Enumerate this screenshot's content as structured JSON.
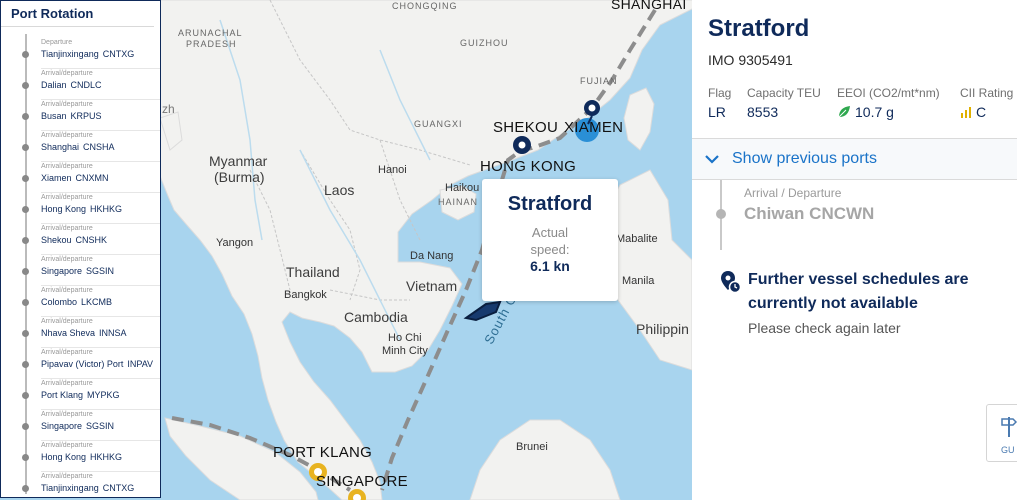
{
  "rotation": {
    "title": "Port Rotation",
    "items": [
      {
        "type": "Departure",
        "name": "Tianjinxingang",
        "code": "CNTXG"
      },
      {
        "type": "Arrival/departure",
        "name": "Dalian",
        "code": "CNDLC"
      },
      {
        "type": "Arrival/departure",
        "name": "Busan",
        "code": "KRPUS"
      },
      {
        "type": "Arrival/departure",
        "name": "Shanghai",
        "code": "CNSHA"
      },
      {
        "type": "Arrival/departure",
        "name": "Xiamen",
        "code": "CNXMN"
      },
      {
        "type": "Arrival/departure",
        "name": "Hong Kong",
        "code": "HKHKG"
      },
      {
        "type": "Arrival/departure",
        "name": "Shekou",
        "code": "CNSHK"
      },
      {
        "type": "Arrival/departure",
        "name": "Singapore",
        "code": "SGSIN"
      },
      {
        "type": "Arrival/departure",
        "name": "Colombo",
        "code": "LKCMB"
      },
      {
        "type": "Arrival/departure",
        "name": "Nhava Sheva",
        "code": "INNSA"
      },
      {
        "type": "Arrival/departure",
        "name": "Pipavav (Victor) Port",
        "code": "INPAV"
      },
      {
        "type": "Arrival/departure",
        "name": "Port Klang",
        "code": "MYPKG"
      },
      {
        "type": "Arrival/departure",
        "name": "Singapore",
        "code": "SGSIN"
      },
      {
        "type": "Arrival/departure",
        "name": "Hong Kong",
        "code": "HKHKG"
      },
      {
        "type": "Arrival/departure",
        "name": "Tianjinxingang",
        "code": "CNTXG"
      }
    ]
  },
  "map": {
    "labels": {
      "shanghai": "SHANGHAI",
      "chongqing": "CHONGQING",
      "guizhou": "GUIZHOU",
      "fujian": "FUJIAN",
      "guangxi": "GUANGXI",
      "hainan": "HAINAN",
      "arunachal": "ARUNACHAL",
      "pradesh": "PRADESH",
      "myanmar": "Myanmar",
      "burma": "(Burma)",
      "laos": "Laos",
      "thailand": "Thailand",
      "cambodia": "Cambodia",
      "vietnam": "Vietnam",
      "philippines": "Philippin",
      "hanoi": "Hanoi",
      "haikou": "Haikou",
      "yangon": "Yangon",
      "bangkok": "Bangkok",
      "danang": "Da Nang",
      "hochiminh1": "Ho Chi",
      "hochiminh2": "Minh City",
      "manila": "Manila",
      "mabalite": "Mabalite",
      "brunei": "Brunei",
      "south_china": "South China",
      "zh_fragment": "zh"
    },
    "ports": {
      "shekou": "SHEKOU",
      "xiamen": "XIAMEN",
      "hong_kong": "HONG KONG",
      "port_klang": "PORT KLANG",
      "singapore": "SINGAPORE"
    }
  },
  "popup": {
    "vessel": "Stratford",
    "speed_label_1": "Actual",
    "speed_label_2": "speed:",
    "speed_value": "6.1 kn"
  },
  "vessel": {
    "name": "Stratford",
    "imo": "IMO 9305491",
    "flag_label": "Flag",
    "flag_value": "LR",
    "teu_label": "Capacity TEU",
    "teu_value": "8553",
    "eeoi_label": "EEOI (CO2/mt*nm)",
    "eeoi_value": "10.7 g",
    "cii_label": "CII Rating",
    "cii_value": "C",
    "leaf_icon_color": "#2fa84f",
    "cii_icon_color": "#e0b000"
  },
  "previous": {
    "toggle_label": "Show previous ports",
    "type": "Arrival / Departure",
    "name": "Chiwan CNCWN"
  },
  "notice": {
    "title": "Further vessel schedules are currently not available",
    "subtitle": "Please check again later"
  },
  "guide": {
    "label": "GU"
  },
  "colors": {
    "brand": "#0f2a5a",
    "link": "#1a73c8",
    "sea": "#a8d4ee",
    "land": "#f2f2f0",
    "port_orange": "#e8b320",
    "port_blue": "#2a8fd6"
  }
}
